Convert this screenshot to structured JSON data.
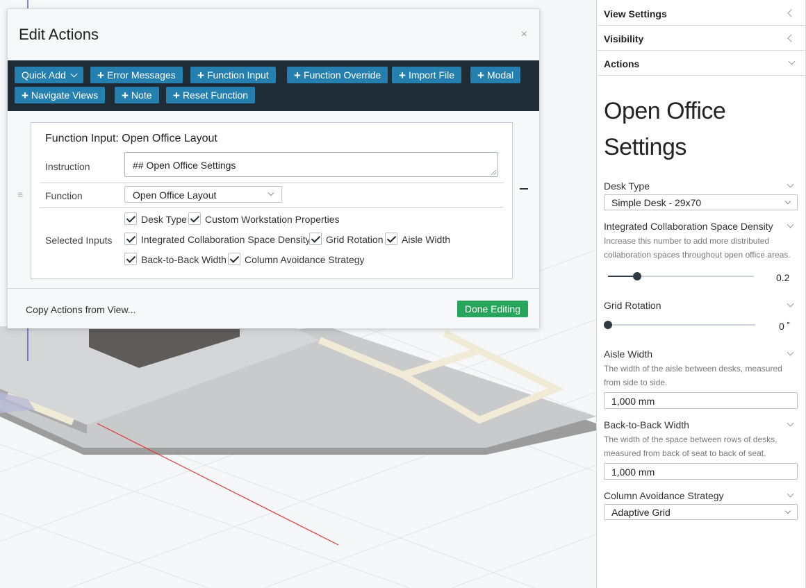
{
  "modal": {
    "title": "Edit Actions",
    "close_glyph": "×",
    "toolbar": {
      "quick_add": "Quick Add",
      "buttons": [
        "Error Messages",
        "Function Input",
        "Function Override",
        "Import File",
        "Modal",
        "Navigate Views",
        "Note",
        "Reset Function"
      ]
    },
    "action": {
      "title": "Function Input: Open Office Layout",
      "instruction_label": "Instruction",
      "instruction_value": "## Open Office Settings",
      "function_label": "Function",
      "function_value": "Open Office Layout",
      "selected_inputs_label": "Selected Inputs",
      "inputs": [
        {
          "label": "Desk Type",
          "checked": true
        },
        {
          "label": "Custom Workstation Properties",
          "checked": true
        },
        {
          "label": "Integrated Collaboration Space Density",
          "checked": true
        },
        {
          "label": "Grid Rotation",
          "checked": true
        },
        {
          "label": "Aisle Width",
          "checked": true
        },
        {
          "label": "Back-to-Back Width",
          "checked": true
        },
        {
          "label": "Column Avoidance Strategy",
          "checked": true
        }
      ]
    },
    "footer": {
      "copy_actions": "Copy Actions from View...",
      "done": "Done Editing"
    }
  },
  "sidebar": {
    "sections": [
      "View Settings",
      "Visibility",
      "Actions"
    ],
    "settings_title": "Open Office Settings",
    "fields": {
      "desk_type": {
        "label": "Desk Type",
        "value": "Simple Desk - 29x70"
      },
      "density": {
        "label": "Integrated Collaboration Space Density",
        "description": "Increase this number to add more distributed collaboration spaces throughout open office areas.",
        "value": "0.2",
        "fraction": 0.2
      },
      "rotation": {
        "label": "Grid Rotation",
        "value": "0 ˚",
        "fraction": 0
      },
      "aisle_width": {
        "label": "Aisle Width",
        "description": "The width of the aisle between desks, measured from side to side.",
        "value": "1,000 mm"
      },
      "back_to_back": {
        "label": "Back-to-Back Width",
        "description": "The width of the space between rows of desks, measured from back of seat to back of seat.",
        "value": "1,000 mm"
      },
      "column_avoidance": {
        "label": "Column Avoidance Strategy",
        "value": "Adaptive Grid"
      }
    }
  },
  "colors": {
    "toolbar_bg": "#1f2b35",
    "toolbar_button": "#2580b0",
    "done_button": "#27a55b"
  }
}
